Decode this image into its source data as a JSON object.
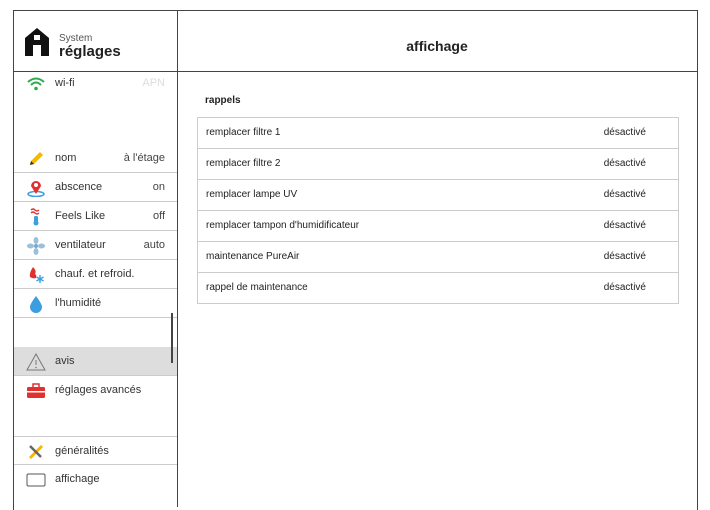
{
  "sidebar": {
    "system_label": "System",
    "title": "réglages",
    "items": [
      {
        "label": "wi-fi",
        "value": "APN"
      },
      {
        "label": "nom",
        "value": "à l'étage"
      },
      {
        "label": "abscence",
        "value": "on"
      },
      {
        "label": "Feels Like",
        "value": "off"
      },
      {
        "label": "ventilateur",
        "value": "auto"
      },
      {
        "label": "chauf. et refroid.",
        "value": ""
      },
      {
        "label": "l'humidité",
        "value": ""
      },
      {
        "label": "avis",
        "value": ""
      },
      {
        "label": "réglages avancés",
        "value": ""
      },
      {
        "label": "généralités",
        "value": ""
      },
      {
        "label": "affichage",
        "value": ""
      }
    ]
  },
  "main": {
    "title": "affichage",
    "section": "rappels",
    "reminders": [
      {
        "label": "remplacer filtre 1",
        "value": "désactivé"
      },
      {
        "label": "remplacer filtre 2",
        "value": "désactivé"
      },
      {
        "label": "remplacer lampe UV",
        "value": "désactivé"
      },
      {
        "label": "remplacer tampon d'humidificateur",
        "value": "désactivé"
      },
      {
        "label": "maintenance PureAir",
        "value": "désactivé"
      },
      {
        "label": "rappel de maintenance",
        "value": "désactivé"
      }
    ]
  },
  "colors": {
    "wifi": "#2eaa4a",
    "accent_red": "#e03030",
    "humidity_blue": "#3a9ee0"
  }
}
